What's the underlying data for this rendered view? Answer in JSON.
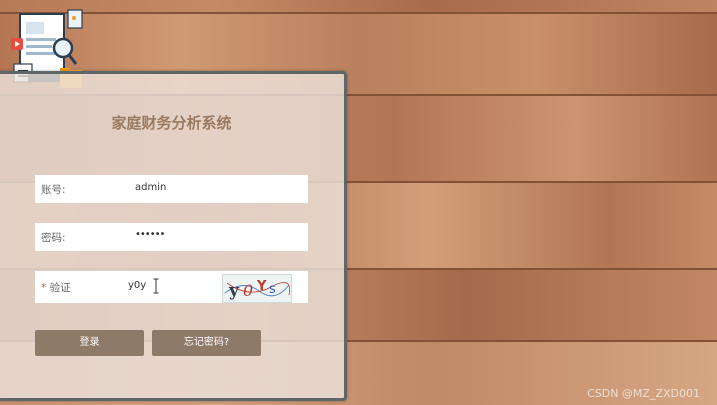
{
  "app": {
    "title": "家庭财务分析系统"
  },
  "form": {
    "account_label": "账号:",
    "account_value": "admin",
    "password_label": "密码:",
    "password_value": "••••••",
    "captcha_required_mark": "*",
    "captcha_label": "验证",
    "captcha_input_value": "y0y",
    "captcha_text": "y0Ys"
  },
  "buttons": {
    "login": "登录",
    "forgot": "忘记密码?"
  },
  "watermark": "CSDN @MZ_ZXD001",
  "icons": [
    "logo-illustration-icon",
    "text-cursor-icon"
  ]
}
